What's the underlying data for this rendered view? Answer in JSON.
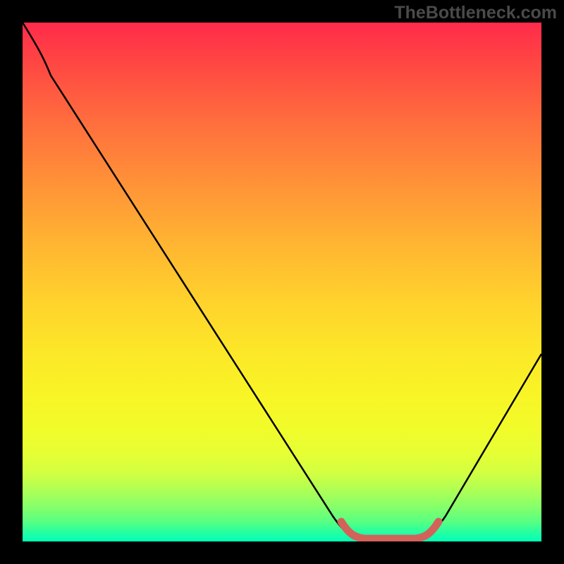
{
  "watermark": "TheBottleneck.com",
  "chart_data": {
    "type": "line",
    "title": "",
    "xlabel": "",
    "ylabel": "",
    "xlim": [
      0,
      100
    ],
    "ylim": [
      0,
      100
    ],
    "series": [
      {
        "name": "curve",
        "color": "#000000",
        "points": [
          {
            "x": 0,
            "y": 100
          },
          {
            "x": 5,
            "y": 93
          },
          {
            "x": 10,
            "y": 88
          },
          {
            "x": 20,
            "y": 73
          },
          {
            "x": 30,
            "y": 58
          },
          {
            "x": 40,
            "y": 43
          },
          {
            "x": 50,
            "y": 28
          },
          {
            "x": 58,
            "y": 14
          },
          {
            "x": 62,
            "y": 6
          },
          {
            "x": 65,
            "y": 1
          },
          {
            "x": 70,
            "y": 0
          },
          {
            "x": 75,
            "y": 0
          },
          {
            "x": 78,
            "y": 1
          },
          {
            "x": 82,
            "y": 6
          },
          {
            "x": 88,
            "y": 16
          },
          {
            "x": 94,
            "y": 26
          },
          {
            "x": 100,
            "y": 36
          }
        ]
      },
      {
        "name": "highlight",
        "color": "#d2635b",
        "points": [
          {
            "x": 62,
            "y": 5
          },
          {
            "x": 65,
            "y": 1
          },
          {
            "x": 70,
            "y": 0
          },
          {
            "x": 75,
            "y": 0
          },
          {
            "x": 78,
            "y": 1
          },
          {
            "x": 80,
            "y": 4
          }
        ]
      }
    ],
    "gradient_background": {
      "top": "#ff2b4b",
      "middle": "#ffe028",
      "bottom": "#00ffb8"
    }
  }
}
